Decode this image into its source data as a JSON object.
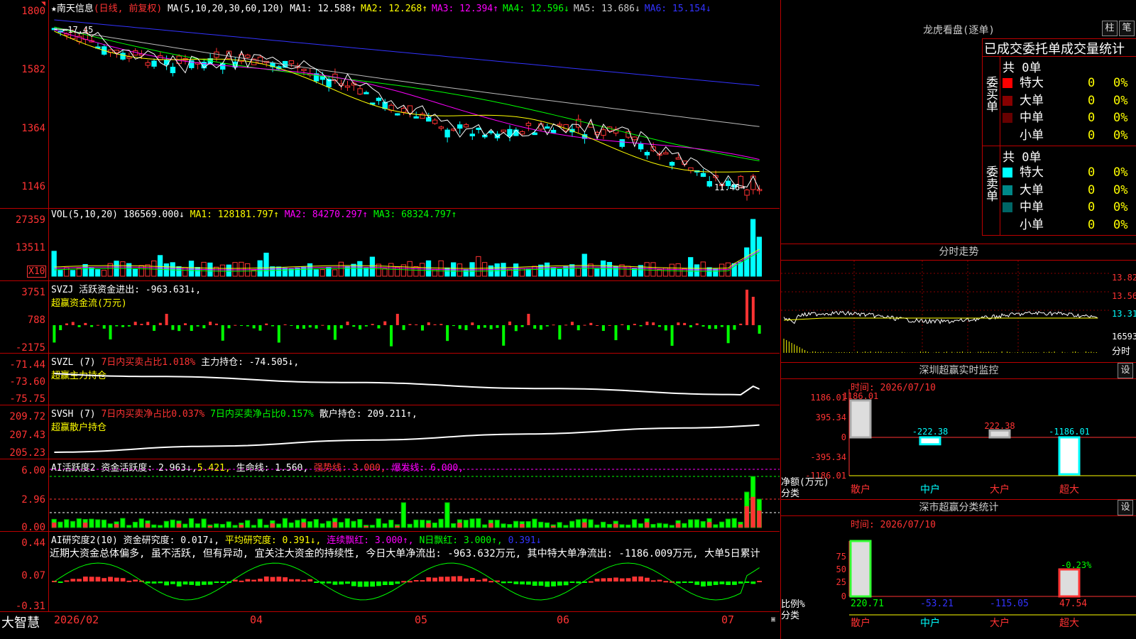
{
  "main": {
    "stock_name": "南天信息",
    "period": "(日线, 前复权)",
    "ma_params": "MA(5,10,20,30,60,120)",
    "ma": [
      {
        "label": "MA1:",
        "value": "12.588↑",
        "color": "#ffffff"
      },
      {
        "label": "MA2:",
        "value": "12.268↑",
        "color": "#ffff00"
      },
      {
        "label": "MA3:",
        "value": "12.394↑",
        "color": "#ff00ff"
      },
      {
        "label": "MA4:",
        "value": "12.596↓",
        "color": "#00ff00"
      },
      {
        "label": "MA5:",
        "value": "13.686↓",
        "color": "#cccccc"
      },
      {
        "label": "MA6:",
        "value": "15.154↓",
        "color": "#3333ff"
      }
    ],
    "y_labels": [
      "1800",
      "1582",
      "1364",
      "1146"
    ],
    "high_marker": "17.45",
    "low_marker": "11.46"
  },
  "vol": {
    "title": "VOL(5,10,20)",
    "value": "186569.000↓",
    "ma1": "MA1: 128181.797↑",
    "ma2": "MA2: 84270.297↑",
    "ma3": "MA3: 68324.797↑",
    "y_labels": [
      "27359",
      "13511"
    ],
    "unit": "X10"
  },
  "svzj": {
    "title": "SVZJ",
    "line1": "活跃资金进出: -963.631↓,",
    "line2": "超赢资金流(万元)",
    "y_labels": [
      "3751",
      "788",
      "-2175"
    ]
  },
  "svzl": {
    "title": "SVZL (7)",
    "part1": "7日内买卖占比1.018%",
    "part2": "主力持仓: -74.505↓,",
    "line2": "超赢主力持仓",
    "y_labels": [
      "-71.44",
      "-73.60",
      "-75.75"
    ]
  },
  "svsh": {
    "title": "SVSH (7)",
    "part1": "7日内买卖净占比0.037%",
    "part2": "7日内买卖净占比0.157%",
    "part3": "散户持仓: 209.211↑,",
    "line2": "超赢散户持仓",
    "y_labels": [
      "209.72",
      "207.43",
      "205.23"
    ]
  },
  "ai_active": {
    "title": "AI活跃度2",
    "part1": "资金活跃度: 2.963↓,",
    "part2": "5.421,",
    "part3": "生命线: 1.560,",
    "part4": "强势线: 3.000,",
    "part5": "爆发线: 6.000,",
    "y_labels": [
      "6.00",
      "2.96",
      "0.00"
    ]
  },
  "ai_research": {
    "title": "AI研究度2(10)",
    "part1": "资金研究度: 0.017↓,",
    "part2": "平均研究度: 0.391↓,",
    "part3": "连续飘红: 3.000↑,",
    "part4": "N日飘红: 3.000↑,",
    "part5": "0.391↓",
    "comment": "近期大资金总体偏多, 虽不活跃, 但有异动, 宜关注大资金的持续性, 今日大单净流出: -963.632万元, 其中特大单净流出: -1186.009万元, 大单5日累计",
    "y_labels": [
      "0.44",
      "0.07",
      "-0.31"
    ]
  },
  "xaxis": {
    "brand": "大智慧",
    "labels": [
      "2026/02",
      "04",
      "05",
      "06",
      "07"
    ]
  },
  "right": {
    "dragon_title": "龙虎看盘(逐单)",
    "btn_zhu": "柱",
    "btn_bi": "笔",
    "table_title": "已成交委托单成交量统计",
    "buy_side": "委买单",
    "sell_side": "委卖单",
    "buy_total": "共 0单",
    "sell_total": "共 0单",
    "buy_rows": [
      {
        "label": "特大",
        "count": "0",
        "pct": "0%",
        "color": "#ff0000"
      },
      {
        "label": "大单",
        "count": "0",
        "pct": "0%",
        "color": "#880000"
      },
      {
        "label": "中单",
        "count": "0",
        "pct": "0%",
        "color": "#660000"
      },
      {
        "label": "小单",
        "count": "0",
        "pct": "0%",
        "color": "#000000"
      }
    ],
    "sell_rows": [
      {
        "label": "特大",
        "count": "0",
        "pct": "0%",
        "color": "#00ffff"
      },
      {
        "label": "大单",
        "count": "0",
        "pct": "0%",
        "color": "#008888"
      },
      {
        "label": "中单",
        "count": "0",
        "pct": "0%",
        "color": "#006666"
      },
      {
        "label": "小单",
        "count": "0",
        "pct": "0%",
        "color": "#000000"
      }
    ],
    "fenshi_title": "分时走势",
    "fenshi_y": [
      "13.82",
      "13.56",
      "13.31"
    ],
    "fenshi_vol": "16593",
    "fenshi_unit": "分时",
    "monitor_title": "深圳超赢实时监控",
    "monitor_btn": "设",
    "monitor_time": "时间: 2026/07/10",
    "monitor_y": [
      "1186.01",
      "395.34",
      "0",
      "-395.34",
      "-1186.01"
    ],
    "monitor_side_label": "净额(万元)",
    "monitor_side_label2": "分类",
    "monitor_values": [
      "1186.01",
      "-222.38",
      "222.38",
      "-1186.01"
    ],
    "categories": [
      "散户",
      "中户",
      "大户",
      "超大"
    ],
    "stats_title": "深市超赢分类统计",
    "stats_btn": "设",
    "stats_time": "时间: 2026/07/10",
    "stats_y": [
      "75",
      "50",
      "25",
      "0"
    ],
    "stats_pct_label": "-0.23%",
    "stats_side_label": "比例%",
    "stats_side_label2": "分类",
    "stats_values": [
      "220.71",
      "-53.21",
      "-115.05",
      "47.54"
    ]
  }
}
